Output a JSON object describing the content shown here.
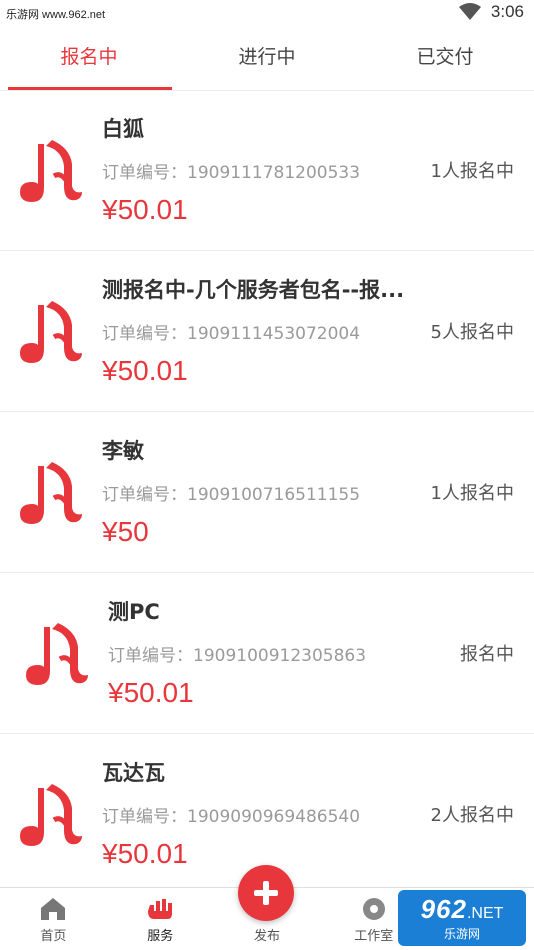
{
  "status_bar": {
    "left_text": "乐游网 www.962.net",
    "time": "3:06"
  },
  "tabs": [
    {
      "label": "报名中",
      "active": true
    },
    {
      "label": "进行中",
      "active": false
    },
    {
      "label": "已交付",
      "active": false
    }
  ],
  "orders": [
    {
      "title": "白狐",
      "order_no": "订单编号：1909111781200533",
      "price": "¥50.01",
      "status": "1人报名中"
    },
    {
      "title": "测报名中-几个服务者包名--报...",
      "order_no": "订单编号：1909111453072004",
      "price": "¥50.01",
      "status": "5人报名中"
    },
    {
      "title": "李敏",
      "order_no": "订单编号：1909100716511155",
      "price": "¥50",
      "status": "1人报名中"
    },
    {
      "title": "测PC",
      "order_no": "订单编号：1909100912305863",
      "price": "¥50.01",
      "status": "报名中"
    },
    {
      "title": "瓦达瓦",
      "order_no": "订单编号：1909090969486540",
      "price": "¥50.01",
      "status": "2人报名中"
    }
  ],
  "bottom_nav": {
    "home": "首页",
    "service": "服务",
    "publish": "发布",
    "studio": "工作室"
  },
  "watermark": {
    "brand": "962",
    "domain": ".NET",
    "sub": "乐游网"
  },
  "colors": {
    "accent": "#e8373c",
    "text": "#333333",
    "muted": "#9a9a9a"
  },
  "icons": [
    "wifi-icon",
    "music-note-logo-icon",
    "home-icon",
    "service-icon",
    "plus-icon",
    "studio-icon"
  ]
}
